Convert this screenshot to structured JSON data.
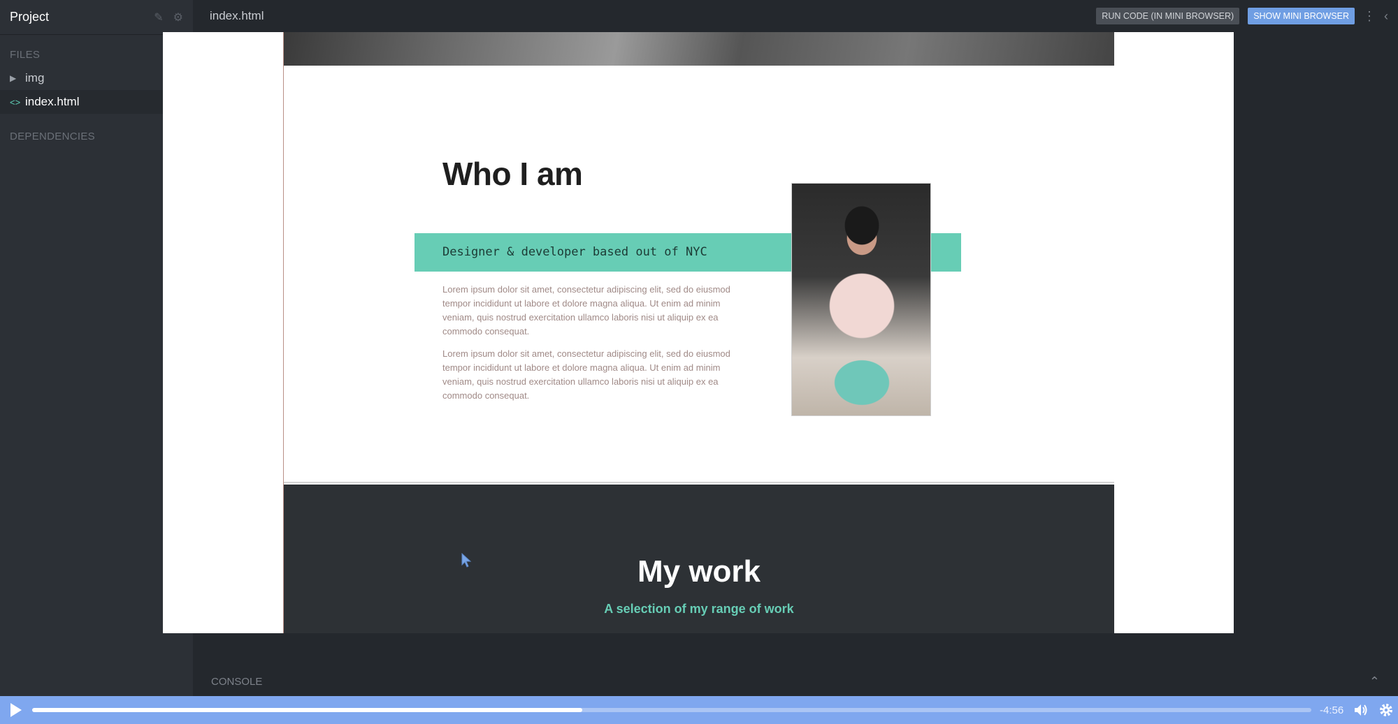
{
  "sidebar": {
    "title": "Project",
    "files_label": "FILES",
    "files": [
      {
        "name": "img",
        "icon": "triangle-right-icon"
      },
      {
        "name": "index.html",
        "icon": "code-icon"
      }
    ],
    "dependencies_label": "DEPENDENCIES"
  },
  "topbar": {
    "tab": "index.html",
    "run_button": "RUN CODE (IN MINI BROWSER)",
    "mini_browser_button": "SHOW MINI BROWSER"
  },
  "console": {
    "label": "CONSOLE"
  },
  "preview": {
    "about": {
      "title": "Who I am",
      "subtitle": "Designer & developer based out of NYC",
      "paragraphs": [
        "Lorem ipsum dolor sit amet, consectetur adipiscing elit, sed do eiusmod tempor incididunt ut labore et dolore magna aliqua. Ut enim ad minim veniam, quis nostrud exercitation ullamco laboris nisi ut aliquip ex ea commodo consequat.",
        "Lorem ipsum dolor sit amet, consectetur adipiscing elit, sed do eiusmod tempor incididunt ut labore et dolore magna aliqua. Ut enim ad minim veniam, quis nostrud exercitation ullamco laboris nisi ut aliquip ex ea commodo consequat."
      ]
    },
    "work": {
      "title": "My work",
      "subtitle": "A selection of my range of work"
    }
  },
  "player": {
    "time_remaining": "-4:56",
    "progress_fraction": 0.43
  },
  "colors": {
    "accent_teal": "#67cdb5",
    "player_blue": "#7fa7ef",
    "sidebar_bg": "#2c3036",
    "editor_bg": "#24282d"
  }
}
